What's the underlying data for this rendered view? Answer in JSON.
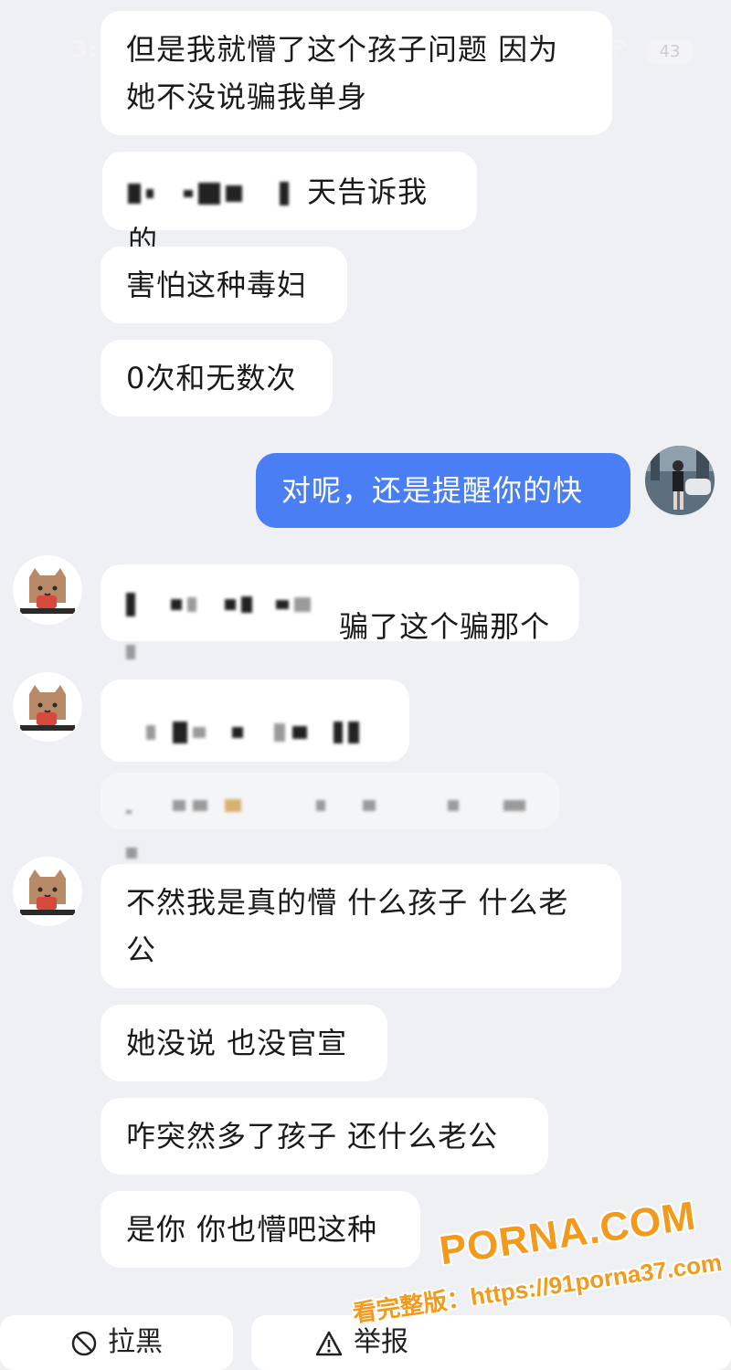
{
  "status_bar": {
    "time": "3:",
    "battery": "43"
  },
  "messages": [
    {
      "side": "left",
      "text": "但是我就懵了这个孩子问题 因为她不没说骗我单身"
    },
    {
      "side": "left",
      "text": "天告诉我的",
      "redacted": true
    },
    {
      "side": "left",
      "text": "害怕这种毒妇"
    },
    {
      "side": "left",
      "text": "0次和无数次"
    },
    {
      "side": "right",
      "text": "对呢，还是提醒你的快"
    },
    {
      "side": "left",
      "text": "骗了这个骗那个",
      "redacted": true
    },
    {
      "side": "left",
      "text": "",
      "redacted": true
    },
    {
      "side": "left",
      "text": "",
      "redacted": true
    },
    {
      "side": "left",
      "text": "不然我是真的懵 什么孩子 什么老公"
    },
    {
      "side": "left",
      "text": "她没说 也没官宣"
    },
    {
      "side": "left",
      "text": "咋突然多了孩子 还什么老公"
    },
    {
      "side": "left",
      "text": "是你 你也懵吧这种"
    }
  ],
  "actions": {
    "block_label": "拉黑",
    "report_label": "举报"
  },
  "watermark": {
    "brand": "PORNA.COM",
    "line": "看完整版：https://91porna37.com"
  },
  "colors": {
    "accent": "#4a7ef5",
    "background": "#eef0f4",
    "bubble": "#ffffff"
  },
  "icons": [
    "wifi-icon",
    "battery-icon",
    "cat-avatar-icon",
    "user-avatar-icon",
    "block-icon",
    "warning-icon"
  ]
}
